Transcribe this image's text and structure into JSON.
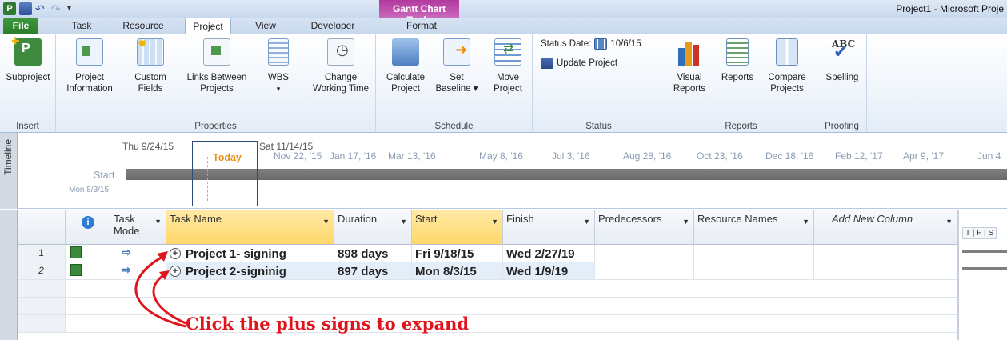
{
  "app": {
    "window_title": "Project1 - Microsoft Proje",
    "contextual_tab_group": "Gantt Chart Tools"
  },
  "tabs": [
    "File",
    "Task",
    "Resource",
    "Project",
    "View",
    "Developer",
    "Format"
  ],
  "ribbon": {
    "insert": {
      "label": "Insert",
      "subproject": "Subproject"
    },
    "properties": {
      "label": "Properties",
      "project_information": [
        "Project",
        "Information"
      ],
      "custom_fields": [
        "Custom",
        "Fields"
      ],
      "links_between_projects": [
        "Links Between",
        "Projects"
      ],
      "wbs": "WBS",
      "change_working_time": [
        "Change",
        "Working Time"
      ]
    },
    "schedule": {
      "label": "Schedule",
      "calculate_project": [
        "Calculate",
        "Project"
      ],
      "set_baseline": [
        "Set",
        "Baseline ▾"
      ],
      "move_project": [
        "Move",
        "Project"
      ]
    },
    "status": {
      "label": "Status",
      "status_date": "Status Date:",
      "status_date_value": "10/6/15",
      "update_project": "Update Project"
    },
    "reports": {
      "label": "Reports",
      "visual_reports": [
        "Visual",
        "Reports"
      ],
      "reports": "Reports",
      "compare_projects": [
        "Compare",
        "Projects"
      ]
    },
    "proofing": {
      "label": "Proofing",
      "spelling": "Spelling"
    }
  },
  "timeline": {
    "side_label": "Timeline",
    "left_date": "Thu 9/24/15",
    "right_date": "Sat 11/14/15",
    "today": "Today",
    "start_label": "Start",
    "start_date": "Mon 8/3/15",
    "scale": [
      "Nov 22, '15",
      "Jan 17, '16",
      "Mar 13, '16",
      "May 8, '16",
      "Jul 3, '16",
      "Aug 28, '16",
      "Oct 23, '16",
      "Dec 18, '16",
      "Feb 12, '17",
      "Apr 9, '17",
      "Jun 4"
    ]
  },
  "grid": {
    "headers": {
      "info": "ℹ",
      "mode": [
        "Task",
        "Mode"
      ],
      "name": "Task Name",
      "duration": "Duration",
      "start": "Start",
      "finish": "Finish",
      "predecessors": "Predecessors",
      "resources": "Resource Names",
      "add": "Add New Column"
    },
    "gantt_header": "T | F | S",
    "rows": [
      {
        "id": "1",
        "name": "Project 1- signing",
        "duration": "898 days",
        "start": "Fri 9/18/15",
        "finish": "Wed 2/27/19"
      },
      {
        "id": "2",
        "name": "Project 2-signinig",
        "duration": "897 days",
        "start": "Mon 8/3/15",
        "finish": "Wed 1/9/19"
      }
    ]
  },
  "annotation": "Click the plus signs to expand",
  "colors": {
    "accent_red": "#e0141c",
    "contextual": "#c760b8",
    "file_tab": "#2d7d2d"
  }
}
